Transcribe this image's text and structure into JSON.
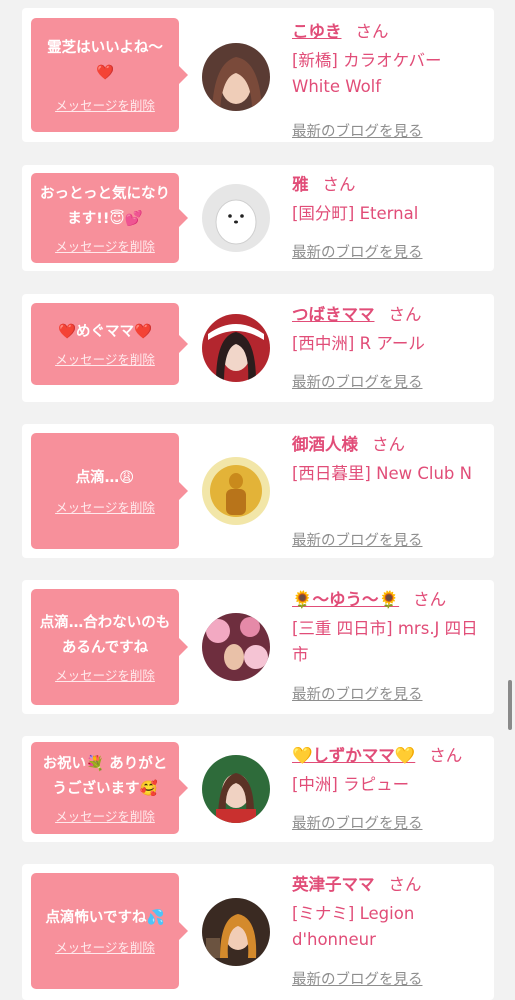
{
  "delete_label": "メッセージを削除",
  "honorific": "さん",
  "blog_label": "最新のブログを見る",
  "colors": {
    "bubble": "#f7909b",
    "accent": "#e14d78",
    "muted": "#8e8e8e",
    "background": "#f2f2f2"
  },
  "entries": [
    {
      "message": "霊芝はいいよね〜❤️",
      "name": "こゆき",
      "shop": "[新橋] カラオケバー White Wolf"
    },
    {
      "message": "おっとっと気になります!!😇💕",
      "name": "雅",
      "shop": "[国分町] Eternal"
    },
    {
      "message": "❤️めぐママ❤️",
      "name": "つばきママ",
      "shop": "[西中洲] R アール"
    },
    {
      "message": "点滴…😩",
      "name": "御酒人様",
      "shop": "[西日暮里] New Club N"
    },
    {
      "message": "点滴…合わないのもあるんですね",
      "name": "🌻〜ゆう〜🌻",
      "shop": "[三重 四日市] mrs.J 四日市"
    },
    {
      "message": "お祝い💐 ありがとうございます🥰",
      "name": "💛しずかママ💛",
      "shop": "[中洲] ラピュー"
    },
    {
      "message": "点滴怖いですね💦",
      "name": "英津子ママ",
      "shop": "[ミナミ] Legion d'honneur"
    }
  ]
}
